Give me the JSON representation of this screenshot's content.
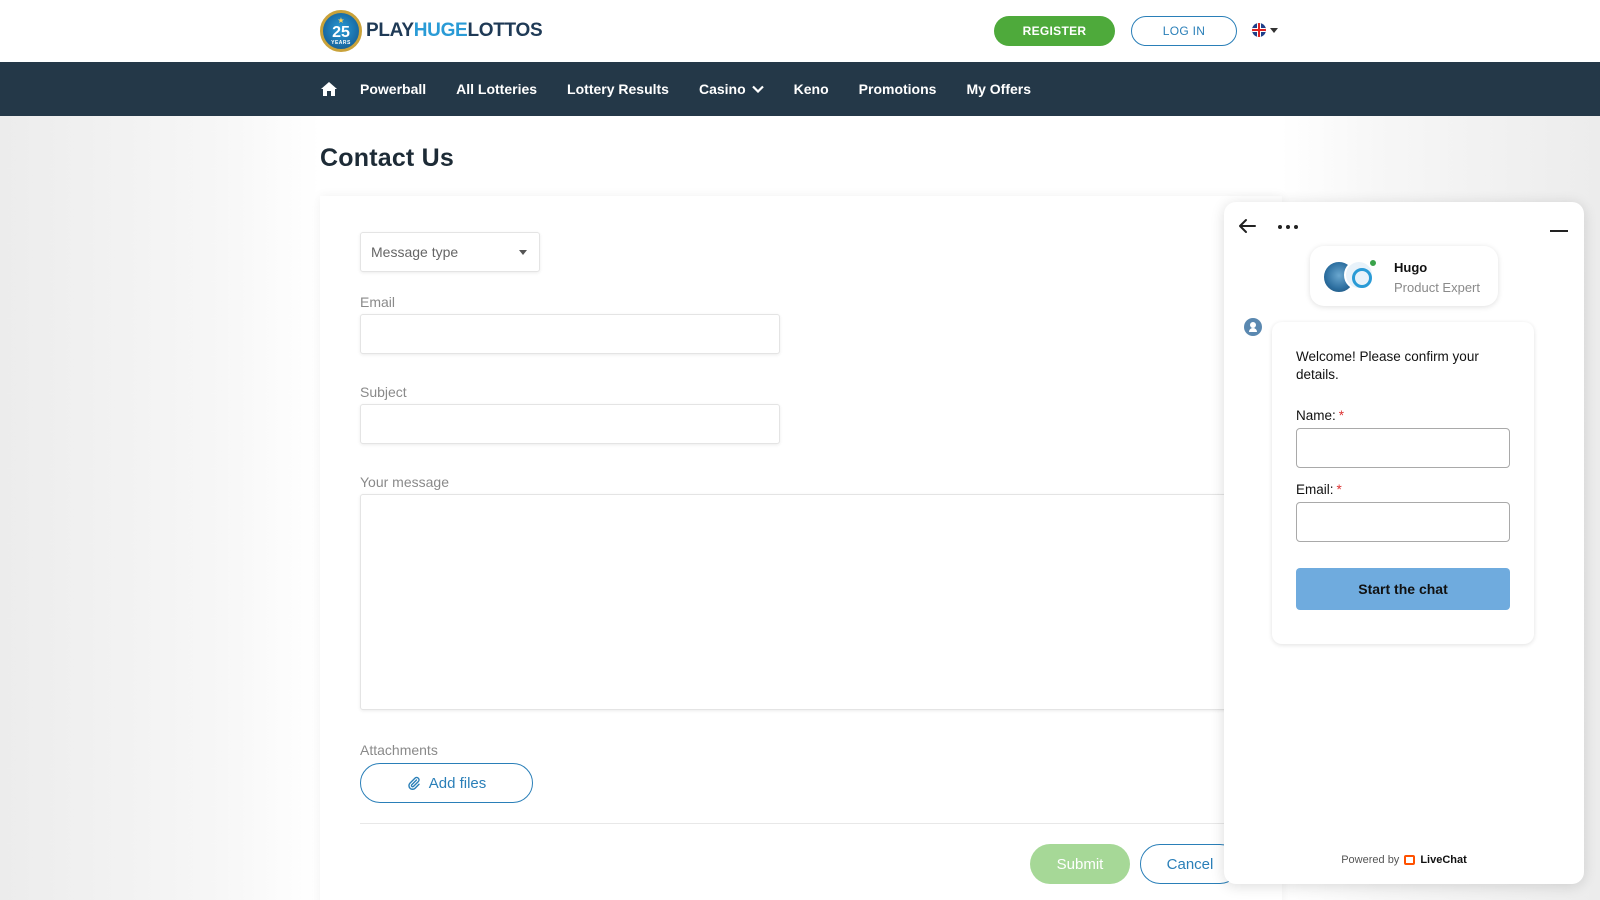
{
  "header": {
    "logo": {
      "badge_number": "25",
      "badge_caption": "YEARS",
      "brand_part1": "PLAY",
      "brand_part2": "HUGE",
      "brand_part3": "LOTTOS"
    },
    "register_label": "REGISTER",
    "login_label": "LOG IN",
    "language_icon": "uk-flag-icon"
  },
  "nav": {
    "items": [
      {
        "label": "Powerball"
      },
      {
        "label": "All Lotteries"
      },
      {
        "label": "Lottery Results"
      },
      {
        "label": "Casino"
      },
      {
        "label": "Keno"
      },
      {
        "label": "Promotions"
      },
      {
        "label": "My Offers"
      }
    ]
  },
  "page": {
    "title": "Contact Us"
  },
  "form": {
    "message_type": {
      "selected": "Message type"
    },
    "email_label": "Email",
    "subject_label": "Subject",
    "message_label": "Your message",
    "attachments_label": "Attachments",
    "add_files_label": "Add files",
    "submit_label": "Submit",
    "cancel_label": "Cancel"
  },
  "chat": {
    "agent_name": "Hugo",
    "agent_role": "Product Expert",
    "welcome": "Welcome! Please confirm your details.",
    "name_label": "Name:",
    "email_label": "Email:",
    "required_mark": "*",
    "start_label": "Start the chat",
    "powered_by": "Powered by",
    "brand": "LiveChat"
  },
  "colors": {
    "nav_bg": "#243848",
    "register_green": "#4eaa3b",
    "accent_blue": "#2a7fb8",
    "submit_disabled": "#a6d897",
    "chat_button": "#6fabde"
  }
}
